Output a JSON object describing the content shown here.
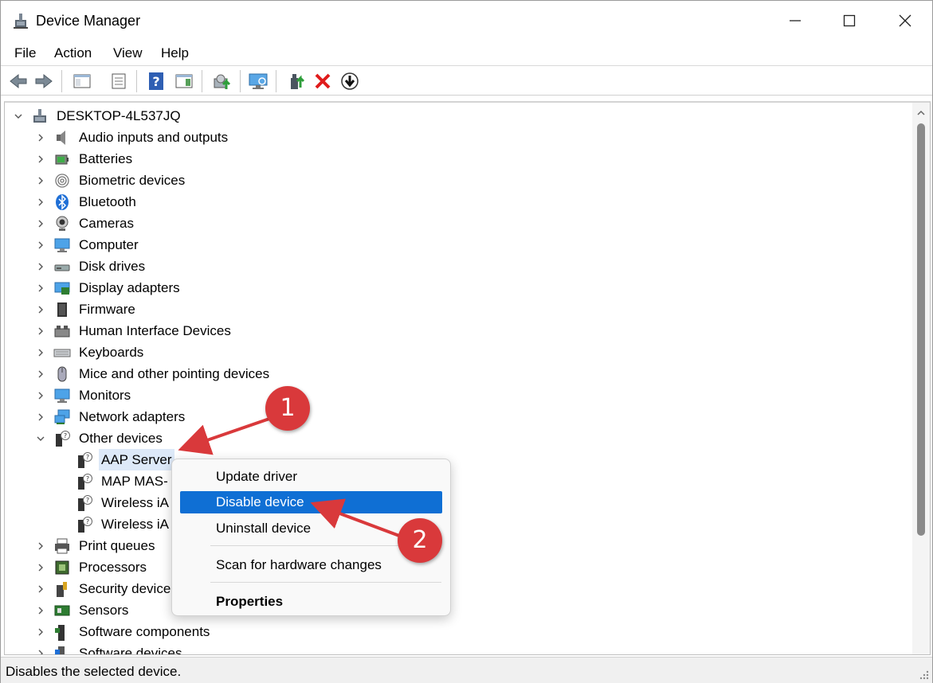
{
  "window": {
    "title": "Device Manager"
  },
  "menu": [
    "File",
    "Action",
    "View",
    "Help"
  ],
  "toolbar": {
    "buttons": [
      "back-icon",
      "forward-icon",
      "show-hide-tree-icon",
      "properties-sheet-icon",
      "help-icon",
      "action-pane-icon",
      "update-driver-icon",
      "scan-hardware-icon",
      "enable-device-icon",
      "uninstall-icon",
      "disable-device-icon"
    ]
  },
  "tree": {
    "root": "DESKTOP-4L537JQ",
    "categories": [
      "Audio inputs and outputs",
      "Batteries",
      "Biometric devices",
      "Bluetooth",
      "Cameras",
      "Computer",
      "Disk drives",
      "Display adapters",
      "Firmware",
      "Human Interface Devices",
      "Keyboards",
      "Mice and other pointing devices",
      "Monitors",
      "Network adapters",
      "Other devices"
    ],
    "other_devices_children": [
      "AAP Server",
      "MAP MAS-",
      "Wireless iA",
      "Wireless iA"
    ],
    "more_categories": [
      "Print queues",
      "Processors",
      "Security device",
      "Sensors",
      "Software components",
      "Software devices"
    ]
  },
  "context_menu": {
    "items": [
      "Update driver",
      "Disable device",
      "Uninstall device",
      "Scan for hardware changes",
      "Properties"
    ],
    "highlighted": "Disable device"
  },
  "status": {
    "text": "Disables the selected device."
  },
  "annotations": {
    "step1": "1",
    "step2": "2",
    "color": "#d9393b"
  }
}
